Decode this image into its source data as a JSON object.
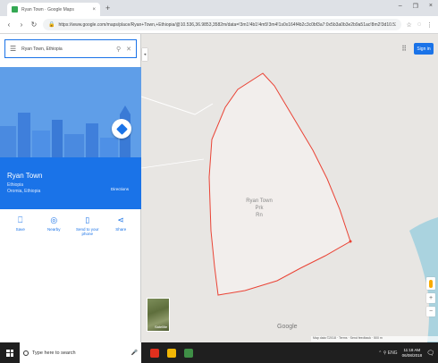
{
  "browser": {
    "tab_title": "Ryan Town · Google Maps",
    "tab_close": "×",
    "new_tab": "+",
    "window_controls": [
      "–",
      "❐",
      "×"
    ],
    "url": "https://www.google.com/maps/place/Ryan+Town,+Ethiopia/@10.536,36.9853,3582m/data=!3m1!4b1!4m5!3m4!1s0x164f4b2c3c0bf3a7:0x5b3a0b3e2b9a51ac!8m2!3d10.5315!4d36.8851",
    "icons": [
      "star-icon",
      "extensions-icon",
      "menu-dots-icon"
    ]
  },
  "panel": {
    "search_value": "Ryan Town, Ethiopia",
    "place_name": "Ryan Town",
    "place_sub1": "Ethiopia",
    "place_sub2": "Oromia, Ethiopia",
    "directions_label": "Directions",
    "collapse_arrow": "◂",
    "actions": [
      {
        "icon": "save-icon",
        "glyph": "⎕",
        "label": "Save"
      },
      {
        "icon": "nearby-icon",
        "glyph": "◎",
        "label": "Nearby"
      },
      {
        "icon": "phone-icon",
        "glyph": "▯",
        "label": "Send to your phone"
      },
      {
        "icon": "share-icon",
        "glyph": "⋖",
        "label": "Share"
      }
    ]
  },
  "map": {
    "sign_in": "Sign in",
    "apps_glyph": "⠿",
    "place_label": "Ryan Town\nPrk\nRn",
    "google_logo": "Google",
    "satellite_label": "Satellite",
    "zoom_in": "+",
    "zoom_out": "−",
    "footer": "Map data ©2018 · Terms · Send feedback · 500 m",
    "boundary_color": "#ea4335",
    "boundary_fill": "#f2eeec",
    "water_color": "#aad3df"
  },
  "taskbar": {
    "search_placeholder": "Type here to search",
    "mic_glyph": "🎤",
    "tray_text": "⌃ ⚲ ENG",
    "time": "11:18 AM",
    "date": "06/08/2018",
    "notif_glyph": "🗨",
    "pinned": [
      {
        "icon": "opera-icon",
        "color": "#e0301e"
      },
      {
        "icon": "chrome-icon",
        "color": "#f2b705"
      },
      {
        "icon": "app-icon",
        "color": "#3f8f46"
      }
    ]
  }
}
